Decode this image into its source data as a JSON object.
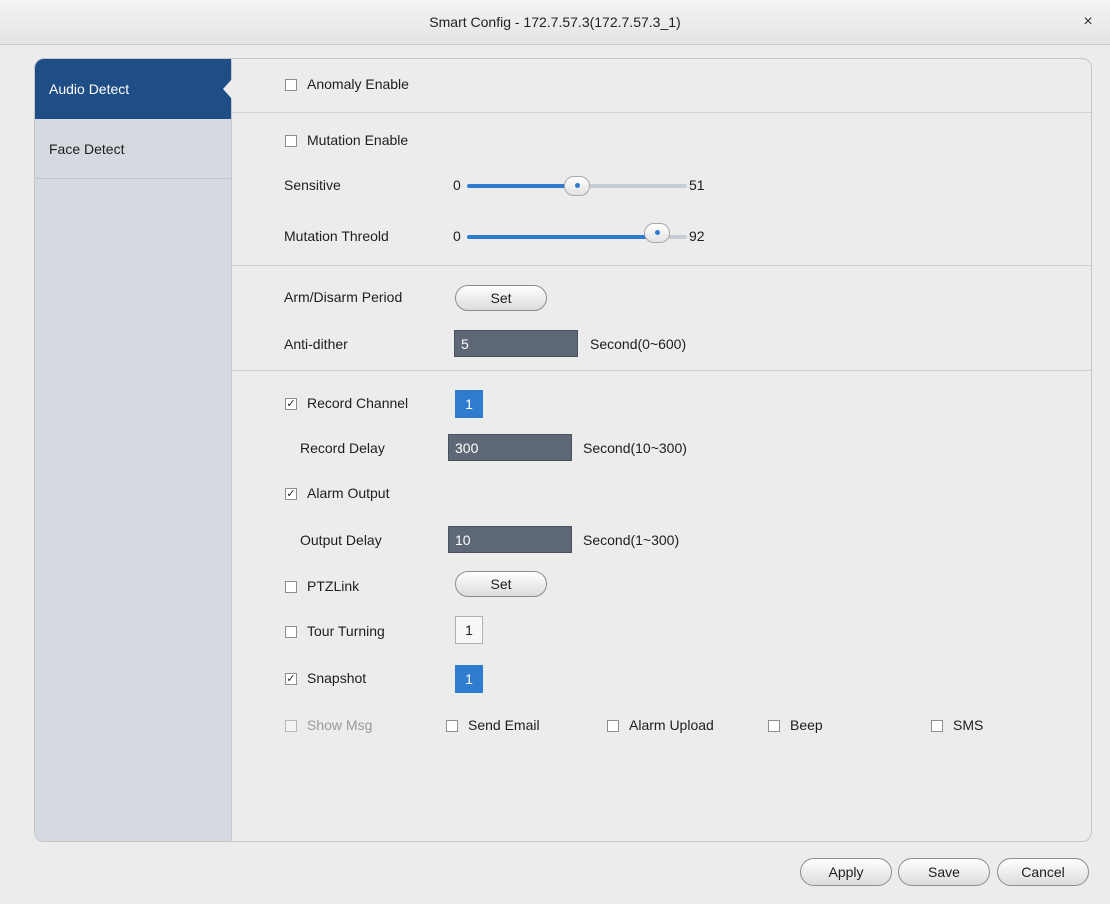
{
  "window": {
    "title": "Smart Config - 172.7.57.3(172.7.57.3_1)",
    "close_glyph": "×"
  },
  "sidebar": {
    "items": [
      {
        "label": "Audio Detect"
      },
      {
        "label": "Face Detect"
      }
    ]
  },
  "anomaly": {
    "label": "Anomaly Enable"
  },
  "mutation": {
    "label": "Mutation Enable",
    "sensitive": {
      "label": "Sensitive",
      "min": "0",
      "max": "51"
    },
    "threshold": {
      "label": "Mutation Threold",
      "min": "0",
      "max": "92"
    }
  },
  "arm": {
    "label": "Arm/Disarm Period",
    "button": "Set"
  },
  "antidither": {
    "label": "Anti-dither",
    "value": "5",
    "unit": "Second(0~600)"
  },
  "record": {
    "label": "Record Channel",
    "channel": "1",
    "delay_label": "Record Delay",
    "delay_value": "300",
    "delay_unit": "Second(10~300)"
  },
  "alarm": {
    "label": "Alarm Output",
    "delay_label": "Output Delay",
    "delay_value": "10",
    "delay_unit": "Second(1~300)"
  },
  "ptz": {
    "label": "PTZLink",
    "button": "Set"
  },
  "tour": {
    "label": "Tour Turning",
    "channel": "1"
  },
  "snapshot": {
    "label": "Snapshot",
    "channel": "1"
  },
  "extras": {
    "show_msg": "Show Msg",
    "send_email": "Send Email",
    "alarm_upload": "Alarm Upload",
    "beep": "Beep",
    "sms": "SMS"
  },
  "footer": {
    "apply": "Apply",
    "save": "Save",
    "cancel": "Cancel"
  },
  "check_glyph": "✓",
  "colors": {
    "accent": "#2e7bd0",
    "sidebar_active": "#1f4d85",
    "input_bg": "#5e6776"
  }
}
